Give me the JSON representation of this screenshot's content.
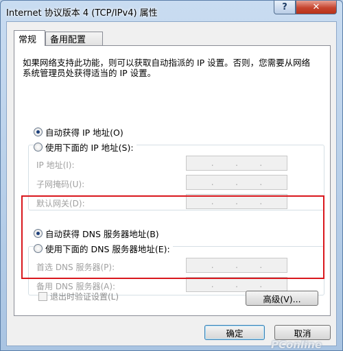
{
  "window": {
    "title": "Internet 协议版本 4 (TCP/IPv4) 属性",
    "help_label": "?",
    "close_label": "✕"
  },
  "tabs": [
    {
      "label": "常规",
      "active": true
    },
    {
      "label": "备用配置",
      "active": false
    }
  ],
  "description": "如果网络支持此功能，则可以获取自动指派的 IP 设置。否则，您需要从网络系统管理员处获得适当的 IP 设置。",
  "ip": {
    "auto_label": "自动获得 IP 地址(O)",
    "manual_label": "使用下面的 IP 地址(S):",
    "auto_selected": true,
    "fields": [
      {
        "label": "IP 地址(I):"
      },
      {
        "label": "子网掩码(U):"
      },
      {
        "label": "默认网关(D):"
      }
    ]
  },
  "dns": {
    "auto_label": "自动获得 DNS 服务器地址(B)",
    "manual_label": "使用下面的 DNS 服务器地址(E):",
    "auto_selected": true,
    "fields": [
      {
        "label": "首选 DNS 服务器(P):"
      },
      {
        "label": "备用 DNS 服务器(A):"
      }
    ]
  },
  "validate_label": "退出时验证设置(L)",
  "buttons": {
    "advanced": "高级(V)...",
    "ok": "确定",
    "cancel": "取消"
  },
  "watermark": "PConline",
  "colors": {
    "highlight_box": "#d9161c",
    "default_button_border": "#3c7fb1"
  },
  "icons": [
    "help-icon",
    "close-icon"
  ]
}
